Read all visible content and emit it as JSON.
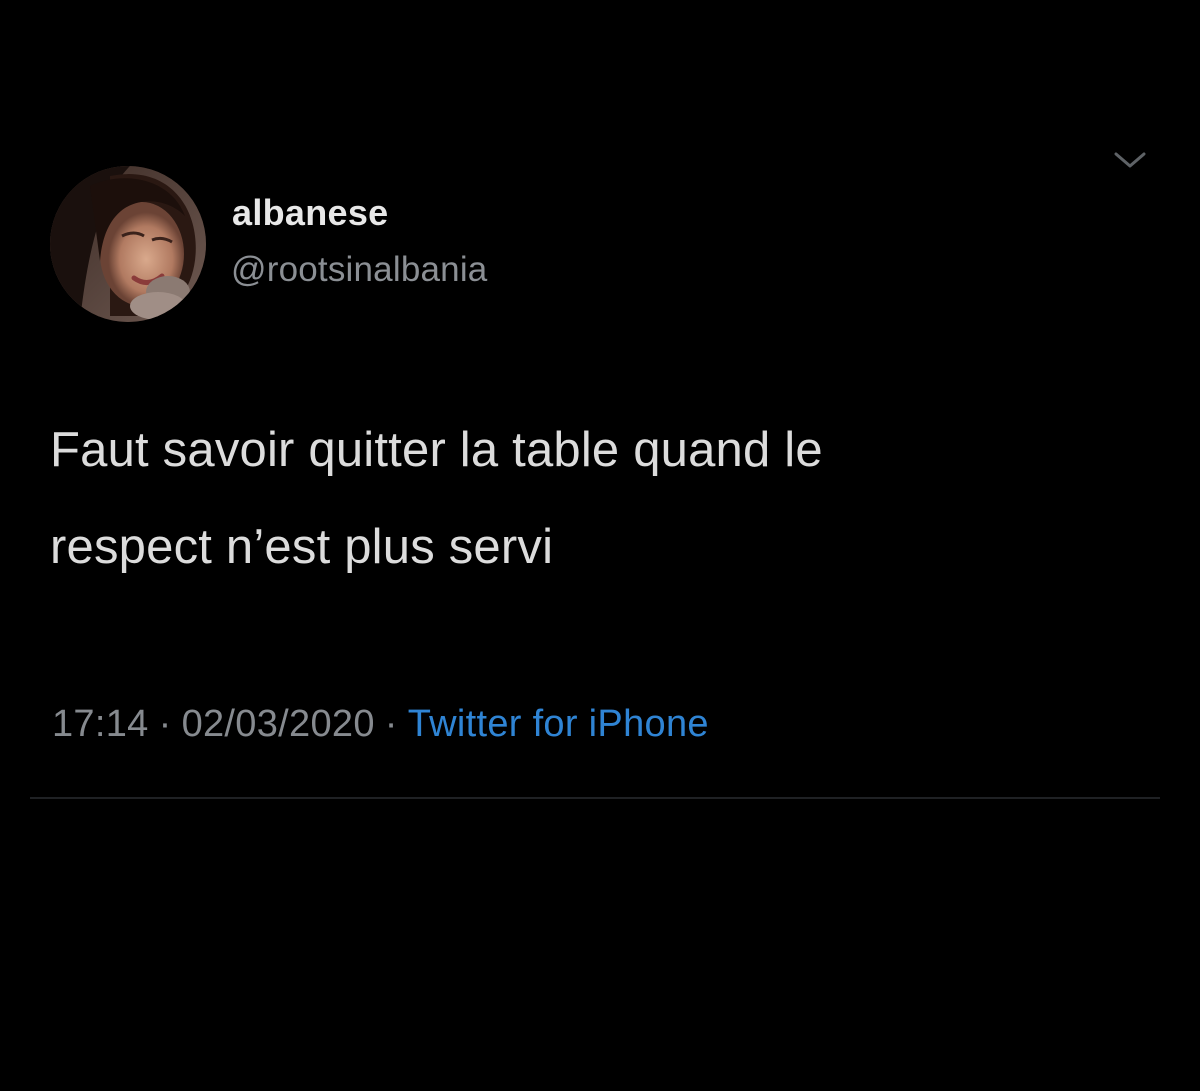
{
  "tweet": {
    "author": {
      "display_name": "albanese",
      "handle": "@rootsinalbania"
    },
    "text_lines": [
      "Faut savoir quitter la table quand le",
      "respect n’est plus servi"
    ],
    "time": "17:14",
    "separator": "·",
    "date": "02/03/2020",
    "source": "Twitter for iPhone"
  },
  "colors": {
    "background": "#000000",
    "primary_text": "#dcdcdc",
    "secondary_text": "#868a8f",
    "link": "#2f84d4"
  },
  "icons": {
    "more_menu": "chevron-down-icon",
    "avatar": "profile-photo"
  }
}
